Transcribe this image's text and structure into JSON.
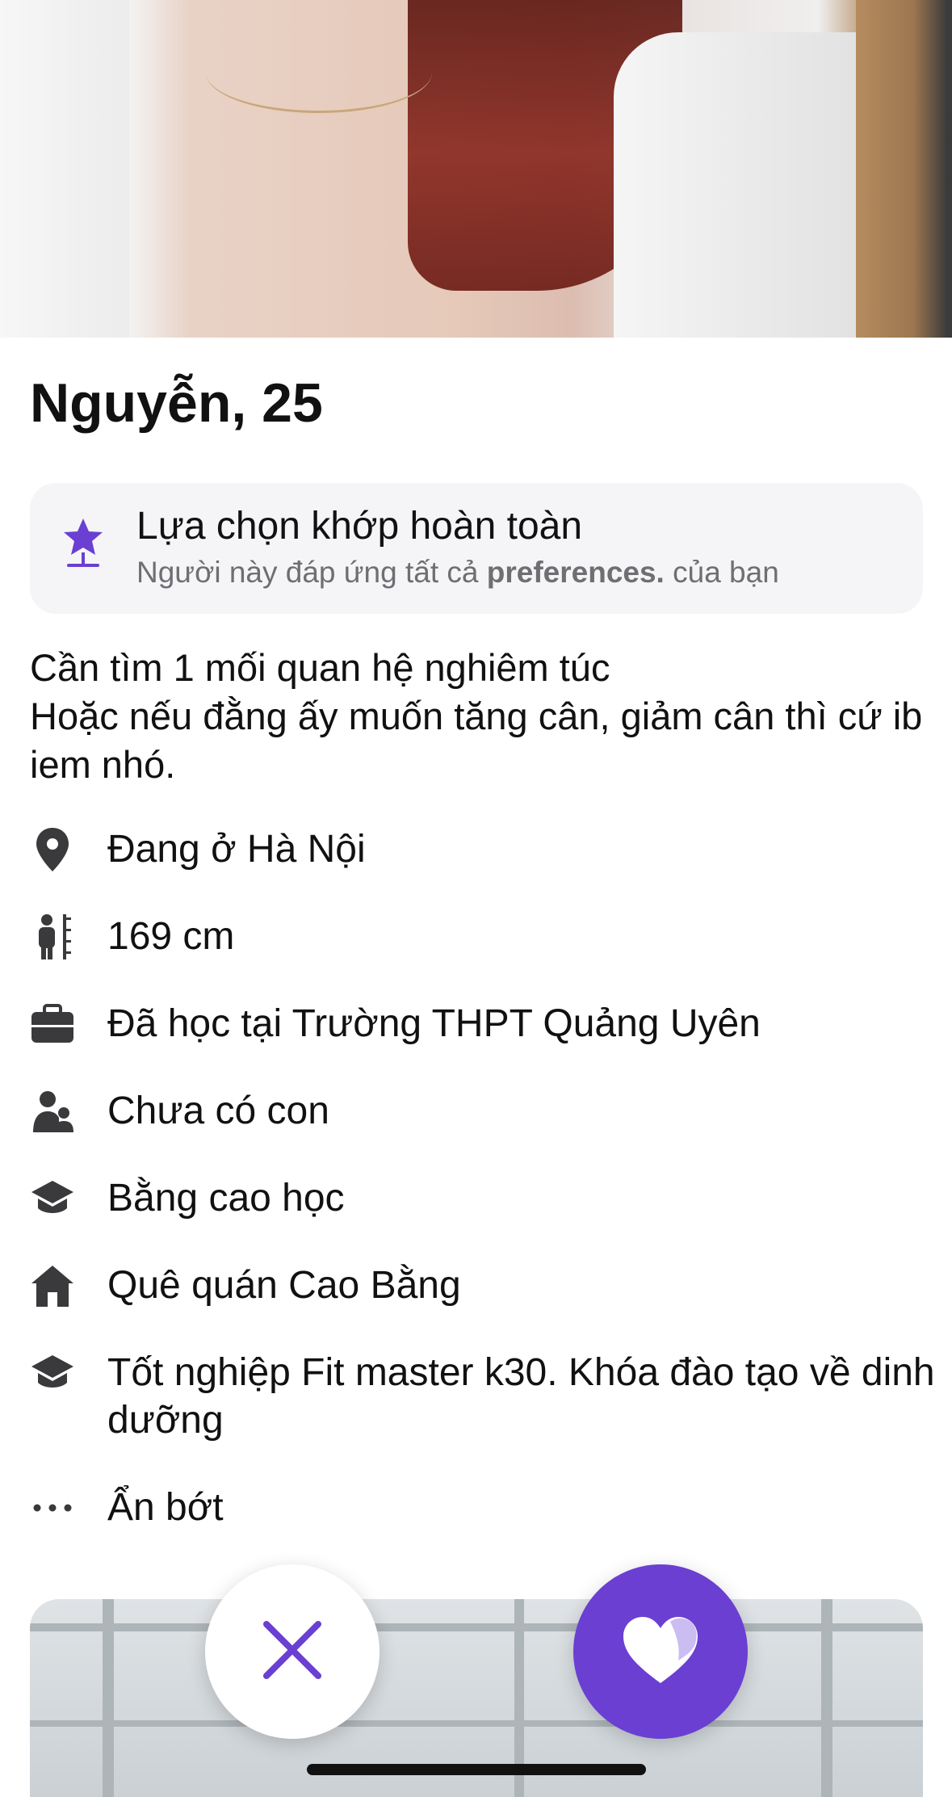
{
  "profile": {
    "name_age": "Nguyễn, 25"
  },
  "match_badge": {
    "title": "Lựa chọn khớp hoàn toàn",
    "subtitle_prefix": "Người này đáp ứng tất cả ",
    "subtitle_bold": "preferences.",
    "subtitle_suffix": " của bạn",
    "icon": "star-icon"
  },
  "bio": {
    "line1": "Cần tìm 1 mối quan hệ nghiêm túc",
    "line2": "Hoặc nếu đằng ấy muốn tăng cân, giảm cân thì cứ ib iem nhó."
  },
  "details": [
    {
      "icon": "location-pin-icon",
      "text": "Đang ở Hà Nội"
    },
    {
      "icon": "height-icon",
      "text": "169 cm"
    },
    {
      "icon": "briefcase-icon",
      "text": "Đã học tại Trường THPT Quảng Uyên"
    },
    {
      "icon": "children-icon",
      "text": "Chưa có con"
    },
    {
      "icon": "graduation-cap-icon",
      "text": "Bằng cao học"
    },
    {
      "icon": "home-icon",
      "text": "Quê quán Cao Bằng"
    },
    {
      "icon": "graduation-cap-icon",
      "text": "Tốt nghiệp Fit master k30. Khóa đào tạo về dinh dưỡng"
    },
    {
      "icon": "more-dots-icon",
      "text": "Ẩn bớt"
    }
  ],
  "actions": {
    "pass_icon": "close-icon",
    "like_icon": "heart-icon"
  },
  "colors": {
    "accent": "#6a3fd2",
    "card_bg": "#f5f5f7",
    "secondary_text": "#6e6e73",
    "icon_gray": "#3a3a3c"
  }
}
